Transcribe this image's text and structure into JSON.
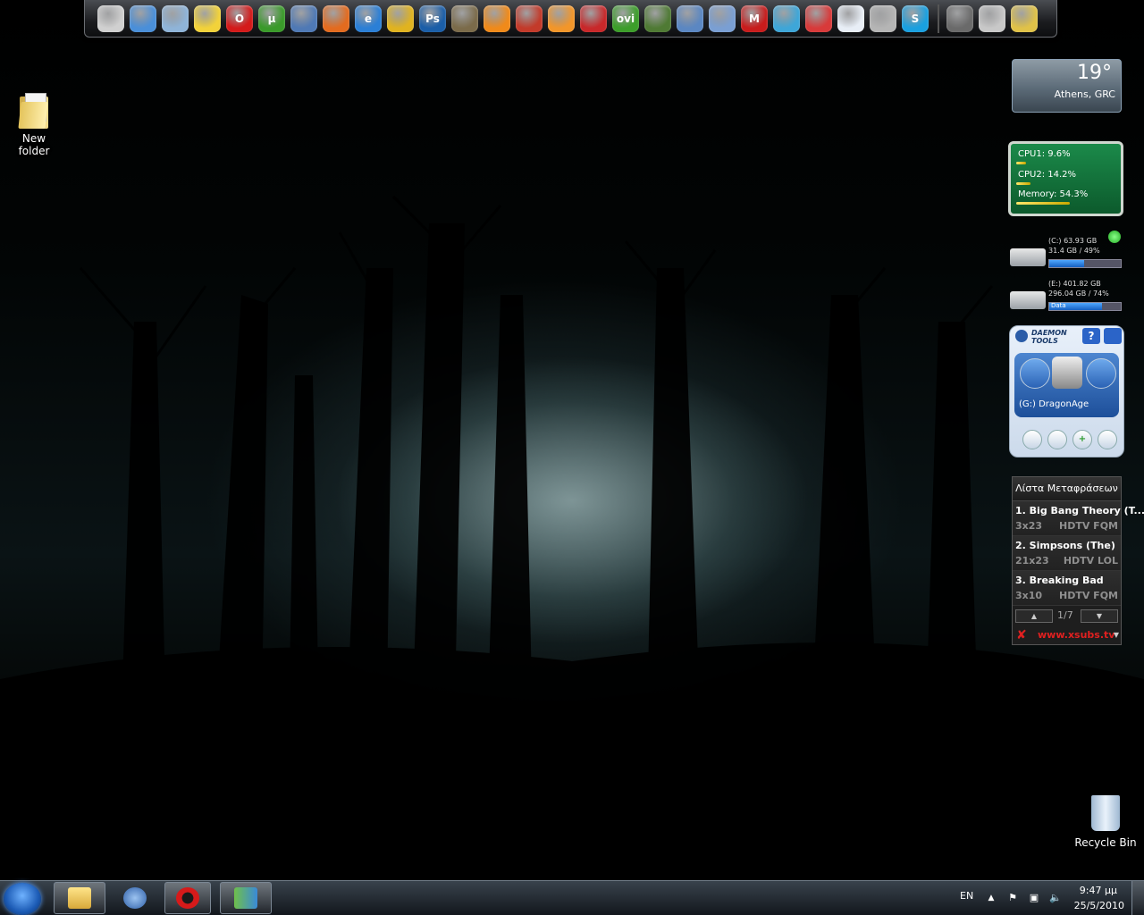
{
  "dock": {
    "icons": [
      {
        "name": "presentation-icon",
        "color": "#d0d0d0",
        "glyph": ""
      },
      {
        "name": "network-globe-icon",
        "color": "#4a8fd9",
        "glyph": ""
      },
      {
        "name": "open-folder-icon",
        "color": "#8fb4d8",
        "glyph": ""
      },
      {
        "name": "smiley-icon",
        "color": "#f2d23a",
        "glyph": ""
      },
      {
        "name": "opera-icon",
        "color": "#d41a1a",
        "glyph": "O"
      },
      {
        "name": "utorrent-icon",
        "color": "#3a9a2a",
        "glyph": "µ"
      },
      {
        "name": "thunderbird-icon",
        "color": "#4f79b5",
        "glyph": ""
      },
      {
        "name": "firefox-icon",
        "color": "#e36b1f",
        "glyph": ""
      },
      {
        "name": "internet-explorer-icon",
        "color": "#2b7fd6",
        "glyph": "e"
      },
      {
        "name": "chrome-icon",
        "color": "#e0b320",
        "glyph": ""
      },
      {
        "name": "photoshop-icon",
        "color": "#1b5ea8",
        "glyph": "Ps"
      },
      {
        "name": "gimp-icon",
        "color": "#7b6b4a",
        "glyph": ""
      },
      {
        "name": "vlc-icon",
        "color": "#f08a1a",
        "glyph": ""
      },
      {
        "name": "lightning-app-icon",
        "color": "#c33a2a",
        "glyph": ""
      },
      {
        "name": "orange-ball-icon",
        "color": "#f2962a",
        "glyph": ""
      },
      {
        "name": "flame-app-icon",
        "color": "#c8282a",
        "glyph": ""
      },
      {
        "name": "ovi-icon",
        "color": "#3c9e2a",
        "glyph": "ovi"
      },
      {
        "name": "tree-icon",
        "color": "#4f7a34",
        "glyph": ""
      },
      {
        "name": "building-icon",
        "color": "#5b87c2",
        "glyph": ""
      },
      {
        "name": "window-app-icon",
        "color": "#7a9fd3",
        "glyph": ""
      },
      {
        "name": "m-app-icon",
        "color": "#c81c1c",
        "glyph": "M"
      },
      {
        "name": "arrow-refresh-icon",
        "color": "#3ea6d8",
        "glyph": ""
      },
      {
        "name": "red-swirl-icon",
        "color": "#d83a3a",
        "glyph": ""
      },
      {
        "name": "star-document-icon",
        "color": "#e8eef6",
        "glyph": ""
      },
      {
        "name": "test-tubes-icon",
        "color": "#b5b5b5",
        "glyph": ""
      },
      {
        "name": "skype-icon",
        "color": "#1aa0e0",
        "glyph": "S"
      },
      {
        "name": "settings-dial-icon",
        "color": "#6a6a6a",
        "glyph": ""
      },
      {
        "name": "map-tools-icon",
        "color": "#c8c8c8",
        "glyph": ""
      },
      {
        "name": "hammer-icon",
        "color": "#e0c248",
        "glyph": ""
      }
    ]
  },
  "desktop": {
    "new_folder_label": "New folder",
    "recycle_bin_label": "Recycle Bin"
  },
  "weather": {
    "temp": "19°",
    "location": "Athens, GRC"
  },
  "cpu": {
    "cpu1": "CPU1: 9.6%",
    "cpu2": "CPU2: 14.2%",
    "memory": "Memory: 54.3%",
    "cpu1_level": 0.096,
    "cpu2_level": 0.142,
    "memory_level": 0.543
  },
  "drives": [
    {
      "line1": "(C:) 63.93 GB",
      "line2": "31.4 GB / 49%",
      "name": "",
      "level": 0.49
    },
    {
      "line1": "(E:) 401.82 GB",
      "line2": "296.04 GB / 74%",
      "name": "Data",
      "level": 0.74
    }
  ],
  "daemon": {
    "brand": "DAEMON TOOLS",
    "help": "?",
    "drive_label": "(G:) DragonAge"
  },
  "subs": {
    "title": "Λίστα Μεταφράσεων",
    "items": [
      {
        "title": "1. Big Bang Theory (T...",
        "episode": "3x23",
        "quality": "HDTV FQM"
      },
      {
        "title": "2. Simpsons (The)",
        "episode": "21x23",
        "quality": "HDTV LOL"
      },
      {
        "title": "3. Breaking Bad",
        "episode": "3x10",
        "quality": "HDTV FQM"
      }
    ],
    "page": "1/7",
    "site": "www.xsubs.tv"
  },
  "taskbar": {
    "language": "EN",
    "time": "9:47 μμ",
    "date": "25/5/2010"
  }
}
